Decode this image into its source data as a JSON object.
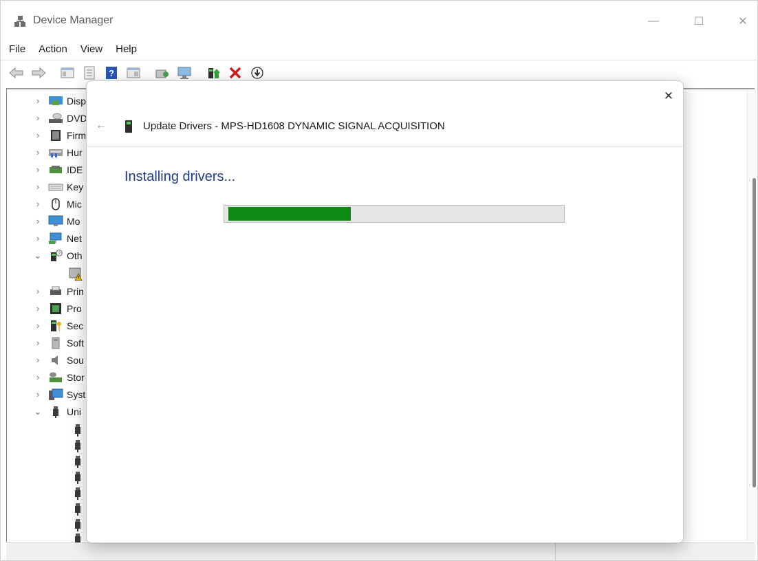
{
  "window": {
    "title": "Device Manager",
    "controls": {
      "minimize": "—",
      "maximize": "☐",
      "close": "✕"
    }
  },
  "menu": [
    "File",
    "Action",
    "View",
    "Help"
  ],
  "toolbar": {
    "icons": [
      "back-arrow-icon",
      "forward-arrow-icon",
      "show-hide-console-tree-icon",
      "properties-icon",
      "help-icon",
      "show-action-pane-icon",
      "scan-hardware-icon",
      "computer-monitor-icon",
      "update-driver-icon",
      "uninstall-device-icon",
      "disable-device-icon"
    ]
  },
  "tree": {
    "categories": [
      {
        "label": "Disp",
        "expander": "›",
        "icon": "display-adapter-icon"
      },
      {
        "label": "DVD",
        "expander": "›",
        "icon": "dvd-drive-icon"
      },
      {
        "label": "Firm",
        "expander": "›",
        "icon": "firmware-icon"
      },
      {
        "label": "Hur",
        "expander": "›",
        "icon": "human-interface-device-icon"
      },
      {
        "label": "IDE",
        "expander": "›",
        "icon": "ide-controller-icon"
      },
      {
        "label": "Key",
        "expander": "›",
        "icon": "keyboard-icon"
      },
      {
        "label": "Mic",
        "expander": "›",
        "icon": "mouse-icon"
      },
      {
        "label": "Mo",
        "expander": "›",
        "icon": "monitor-icon"
      },
      {
        "label": "Net",
        "expander": "›",
        "icon": "network-adapter-icon"
      },
      {
        "label": "Oth",
        "expander": "⌄",
        "icon": "other-devices-icon"
      },
      {
        "label": "Prin",
        "expander": "›",
        "icon": "print-queue-icon"
      },
      {
        "label": "Pro",
        "expander": "›",
        "icon": "processor-icon"
      },
      {
        "label": "Sec",
        "expander": "›",
        "icon": "security-device-icon"
      },
      {
        "label": "Soft",
        "expander": "›",
        "icon": "software-device-icon"
      },
      {
        "label": "Sou",
        "expander": "›",
        "icon": "sound-icon"
      },
      {
        "label": "Stor",
        "expander": "›",
        "icon": "storage-controller-icon"
      },
      {
        "label": "Syst",
        "expander": "›",
        "icon": "system-device-icon"
      },
      {
        "label": "Uni",
        "expander": "⌄",
        "icon": "usb-controller-icon"
      }
    ],
    "other_children_icons": [
      "unknown-device-warning-icon"
    ],
    "usb_children_count_visible": 8
  },
  "dialog": {
    "close": "✕",
    "back": "←",
    "title": "Update Drivers - MPS-HD1608 DYNAMIC SIGNAL ACQUISITION",
    "heading": "Installing drivers...",
    "progress_fraction": 0.37,
    "progress_color": "#0c8a13",
    "heading_color": "#1f3c8a"
  }
}
